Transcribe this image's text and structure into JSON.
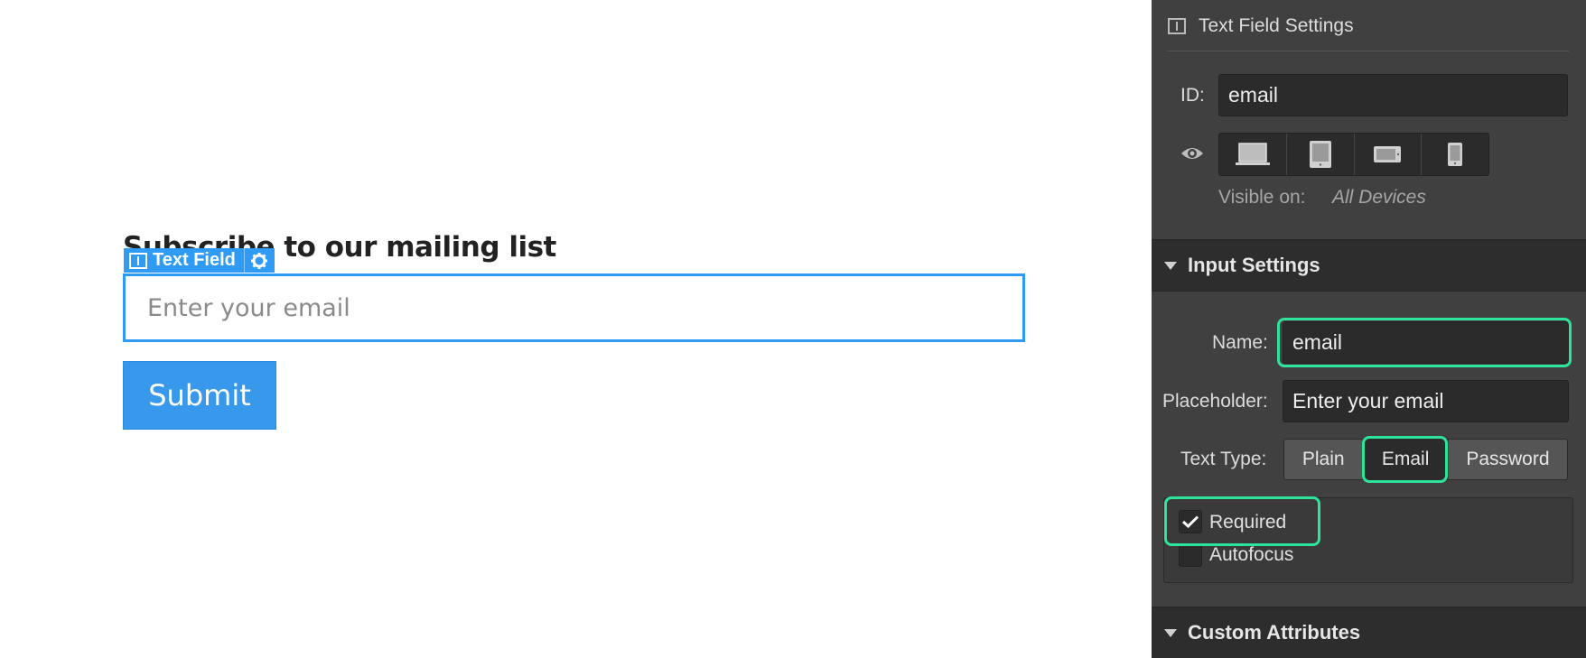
{
  "canvas": {
    "heading": "Subscribe to our mailing list",
    "badge_label": "Text Field",
    "email_placeholder": "Enter your email",
    "submit_label": "Submit"
  },
  "panel": {
    "title": "Text Field Settings",
    "id_label": "ID:",
    "id_value": "email",
    "devices": [
      "desktop-icon",
      "tablet-icon",
      "mobile-landscape-icon",
      "mobile-portrait-icon"
    ],
    "visible_on_label": "Visible on:",
    "visible_on_value": "All Devices",
    "input_settings": {
      "title": "Input Settings",
      "name_label": "Name:",
      "name_value": "email",
      "placeholder_label": "Placeholder:",
      "placeholder_value": "Enter your email",
      "text_type_label": "Text Type:",
      "text_types": [
        "Plain",
        "Email",
        "Password"
      ],
      "text_type_selected": "Email",
      "required_label": "Required",
      "required_checked": true,
      "autofocus_label": "Autofocus",
      "autofocus_checked": false
    },
    "custom_attributes_title": "Custom Attributes"
  },
  "colors": {
    "selection_blue": "#2f9bf4",
    "button_blue": "#3898ec",
    "panel_bg": "#404040",
    "highlight_green": "#2ee39a"
  }
}
